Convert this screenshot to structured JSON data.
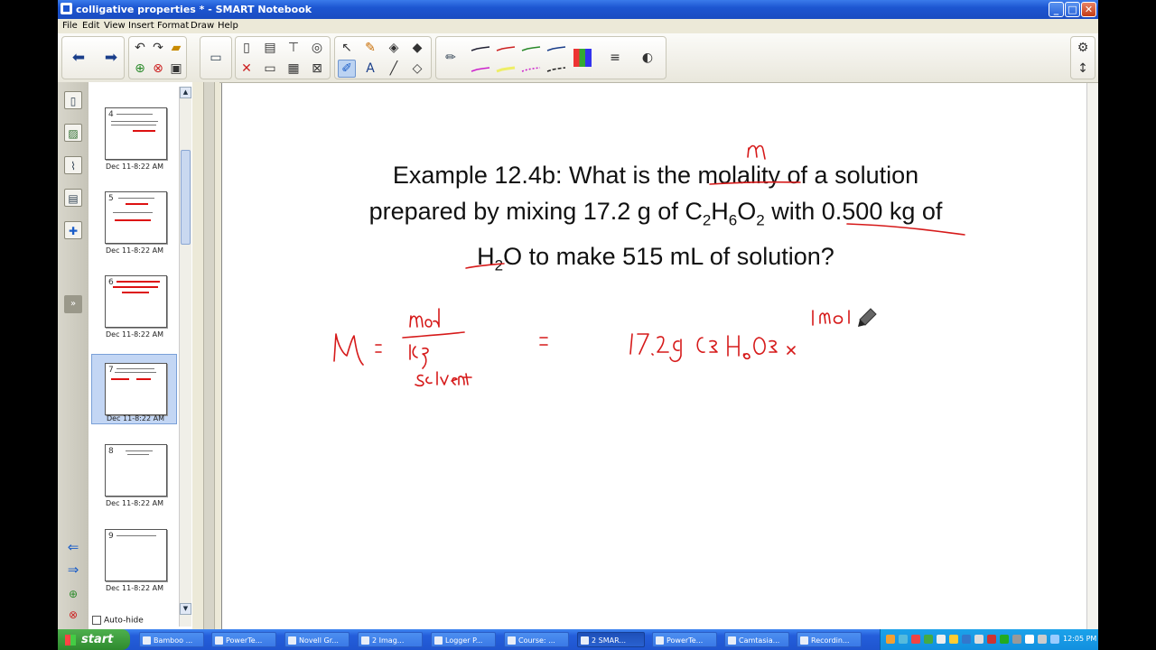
{
  "window": {
    "title": "colligative properties * - SMART Notebook",
    "min": "_",
    "max": "□",
    "close": "✕"
  },
  "menu": [
    "File",
    "Edit",
    "View",
    "Insert",
    "Format",
    "Draw",
    "Help"
  ],
  "toolbar": {
    "back_icon": "⬅",
    "forward_icon": "➡",
    "settings_icon": "⚙",
    "move_icon": "↕"
  },
  "question": {
    "line1": "Example 12.4b: What is the molality of a solution",
    "line2_a": "prepared by mixing 17.2 g of C",
    "line2_sub1": "2",
    "line2_b": "H",
    "line2_sub2": "6",
    "line2_c": "O",
    "line2_sub3": "2",
    "line2_d": " with 0.500 kg of",
    "line3_a": "H",
    "line3_sub": "2",
    "line3_b": "O to make 515 mL of solution?"
  },
  "slides": [
    {
      "num": "4",
      "date": "Dec 11-8:22 AM"
    },
    {
      "num": "5",
      "date": "Dec 11-8:22 AM"
    },
    {
      "num": "6",
      "date": "Dec 11-8:22 AM"
    },
    {
      "num": "7",
      "date": "Dec 11-8:22 AM"
    },
    {
      "num": "8",
      "date": "Dec 11-8:22 AM"
    },
    {
      "num": "9",
      "date": "Dec 11-8:22 AM"
    }
  ],
  "autohide": "Auto-hide",
  "taskbar": {
    "start": "start",
    "tasks": [
      "Bamboo ...",
      "PowerTe...",
      "Novell Gr...",
      "2 Imag...",
      "Logger P...",
      "Course: ...",
      "2 SMAR...",
      "PowerTe...",
      "Camtasia...",
      "Recordin..."
    ],
    "clock": "12:05 PM"
  }
}
